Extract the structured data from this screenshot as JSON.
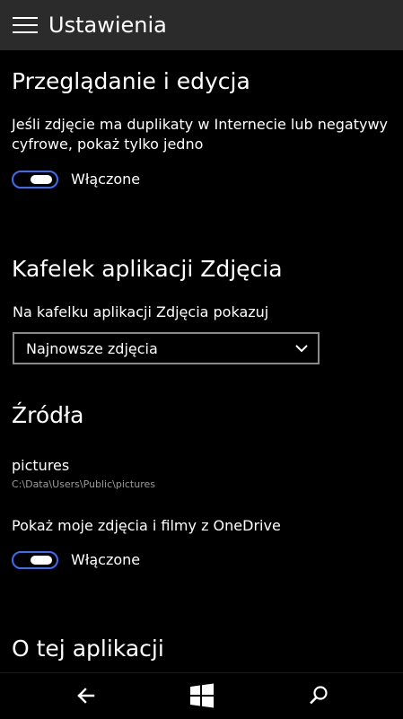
{
  "header": {
    "title": "Ustawienia",
    "menu_icon": "hamburger-menu-icon"
  },
  "browsing": {
    "heading": "Przeglądanie i edycja",
    "description": "Jeśli zdjęcie ma duplikaty w Internecie lub negatywy cyfrowe, pokaż tylko jedno",
    "toggle_state": "on",
    "toggle_label": "Włączone"
  },
  "tile": {
    "heading": "Kafelek aplikacji Zdjęcia",
    "dropdown_label": "Na kafelku aplikacji Zdjęcia pokazuj",
    "dropdown_value": "Najnowsze zdjęcia",
    "dropdown_icon": "chevron-down-icon"
  },
  "sources": {
    "heading": "Źródła",
    "folder_name": "pictures",
    "folder_path": "C:\\Data\\Users\\Public\\pictures",
    "onedrive_label": "Pokaż moje zdjęcia i filmy z OneDrive",
    "toggle_state": "on",
    "toggle_label": "Włączone"
  },
  "about": {
    "heading": "O tej aplikacji"
  },
  "navbar": {
    "back_icon": "back-arrow-icon",
    "home_icon": "windows-logo-icon",
    "search_icon": "search-icon"
  },
  "colors": {
    "background": "#000000",
    "titlebar": "#2b2b2b",
    "accent": "#3b6cf5",
    "dropdown_border": "#8a8a8a",
    "secondary_text": "#9a9a9a"
  }
}
